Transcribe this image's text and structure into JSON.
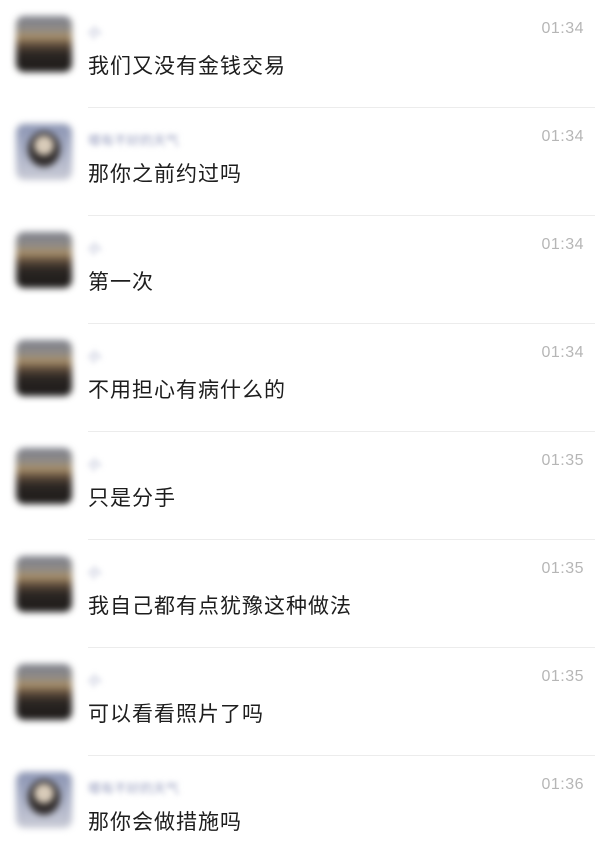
{
  "messages": [
    {
      "sender": "小",
      "avatar": "landscape-avatar",
      "time": "01:34",
      "text": "我们又没有金钱交易"
    },
    {
      "sender": "哪有不好的天气",
      "avatar": "person-avatar",
      "time": "01:34",
      "text": "那你之前约过吗"
    },
    {
      "sender": "小",
      "avatar": "landscape-avatar",
      "time": "01:34",
      "text": "第一次"
    },
    {
      "sender": "小",
      "avatar": "landscape-avatar",
      "time": "01:34",
      "text": "不用担心有病什么的"
    },
    {
      "sender": "小",
      "avatar": "landscape-avatar",
      "time": "01:35",
      "text": "只是分手"
    },
    {
      "sender": "小",
      "avatar": "landscape-avatar",
      "time": "01:35",
      "text": "我自己都有点犹豫这种做法"
    },
    {
      "sender": "小",
      "avatar": "landscape-avatar",
      "time": "01:35",
      "text": "可以看看照片了吗"
    },
    {
      "sender": "哪有不好的天气",
      "avatar": "person-avatar",
      "time": "01:36",
      "text": "那你会做措施吗"
    }
  ]
}
